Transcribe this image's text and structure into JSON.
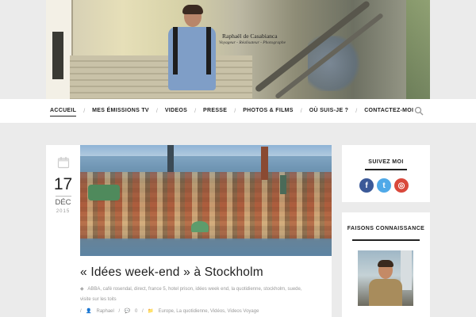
{
  "site": {
    "name": "Raphaël de Casabianca",
    "tagline": "Voyageur - Réalisateur - Photographe"
  },
  "nav": {
    "items": [
      {
        "label": "Accueil",
        "active": true
      },
      {
        "label": "Mes émissions TV",
        "active": false
      },
      {
        "label": "Videos",
        "active": false
      },
      {
        "label": "Presse",
        "active": false
      },
      {
        "label": "Photos & Films",
        "active": false
      },
      {
        "label": "Où suis-je ?",
        "active": false
      },
      {
        "label": "Contactez-moi",
        "active": false
      }
    ],
    "search_icon": "search-icon"
  },
  "post": {
    "day": "17",
    "month": "déc",
    "year": "2015",
    "date_icon": "calendar-icon",
    "title": "« Idées week-end » à Stockholm",
    "tags": "ABBA, café rosendal, direct, france 5, hotel prison, idées week end, la quotidienne, stockholm, suede, visite sur les toits",
    "author": "Raphael",
    "comments": "0",
    "categories": "Europe, La quotidienne, Vidéos, Videos Voyage"
  },
  "sidebar": {
    "follow_title": "Suivez moi",
    "social": [
      {
        "name": "facebook-icon",
        "glyph": "f"
      },
      {
        "name": "twitter-icon",
        "glyph": "t"
      },
      {
        "name": "instagram-icon",
        "glyph": "◎"
      }
    ],
    "about_title": "Faisons connaissance"
  },
  "colors": {
    "background": "#ebebeb",
    "card": "#ffffff",
    "facebook": "#3b5998",
    "twitter": "#4fa9e8",
    "instagram": "#d9483b"
  }
}
